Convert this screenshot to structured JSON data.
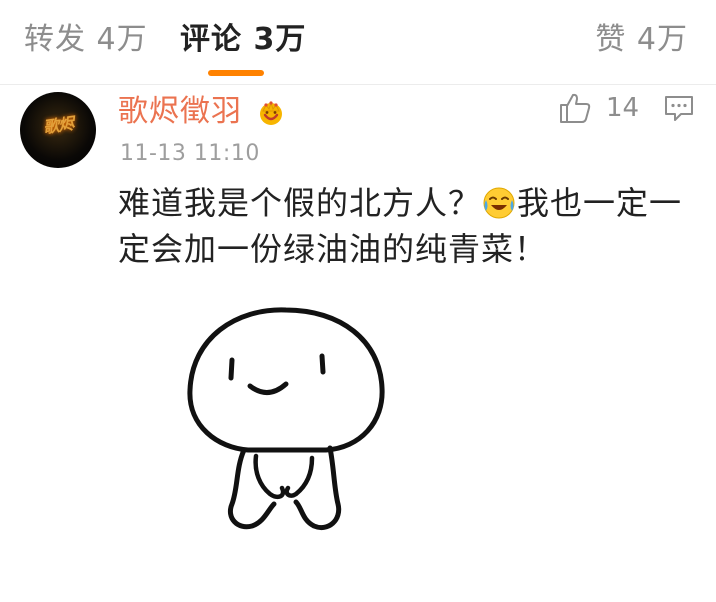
{
  "tabs": {
    "repost": "转发 4万",
    "comments": "评论 3万",
    "likes": "赞 4万",
    "active": "comments",
    "accent_color": "#ff8200"
  },
  "comment": {
    "username": "歌烬徵羽",
    "username_color": "#eb7350",
    "avatar_text": "歌烬",
    "badge_icon": "vip-crown-icon",
    "timestamp": "11-13 11:10",
    "like_count": "14",
    "like_icon": "thumbs-up-icon",
    "reply_icon": "comment-bubble-icon",
    "text_part1": "难道我是个假的北方人？",
    "emoji": "laugh-cry-emoji-icon",
    "text_part2": "我也一定一定会加一份绿油油的纯青菜！",
    "sticker": "smiling-doodle-figure-sticker"
  }
}
